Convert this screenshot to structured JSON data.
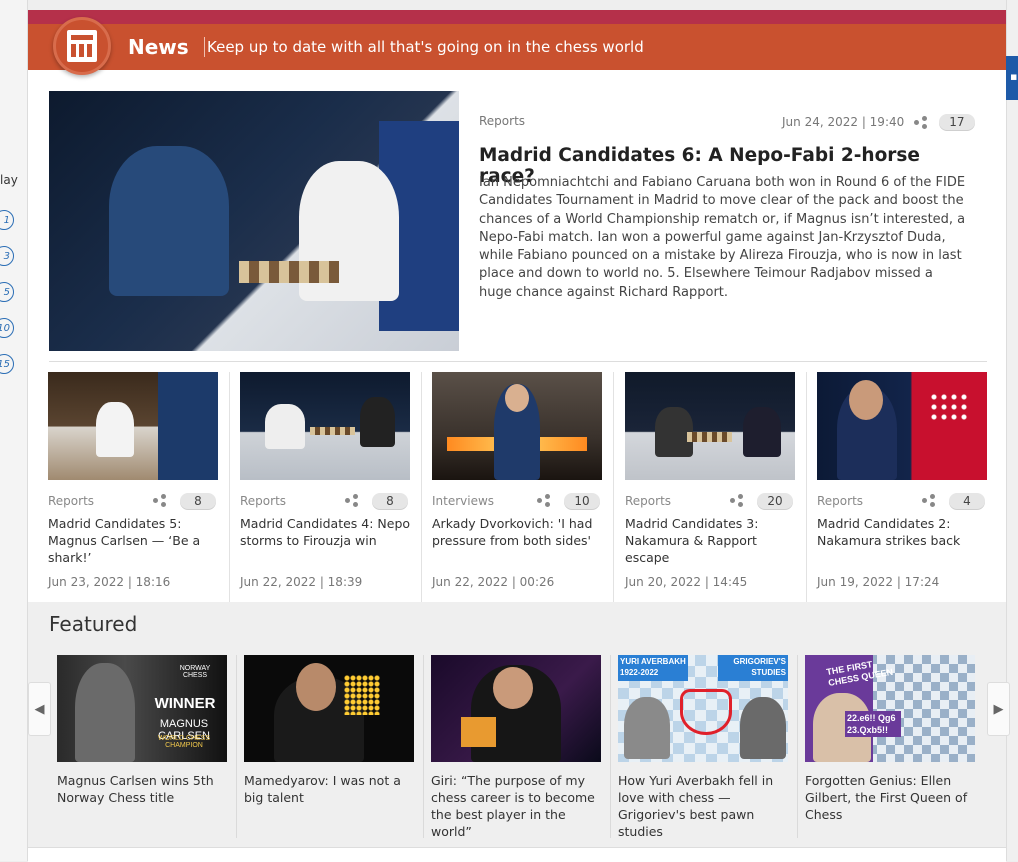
{
  "left_sidebar": {
    "label": "lay",
    "items": [
      "1",
      "3",
      "5",
      "10",
      "15"
    ]
  },
  "banner": {
    "title": "News",
    "subtitle": "Keep up to date with all that's going on in the chess world",
    "color": "#c9512f",
    "topline_color": "#b5304a"
  },
  "hero": {
    "category": "Reports",
    "date": "Jun 24, 2022 | 19:40",
    "comments": "17",
    "title": "Madrid Candidates 6: A Nepo-Fabi 2-horse race?",
    "summary": "Ian Nepomniachtchi and Fabiano Caruana both won in Round 6 of the FIDE Candidates Tournament in Madrid to move clear of the pack and boost the chances of a World Championship rematch or, if Magnus isn’t interested, a Nepo-Fabi match. Ian won a powerful game against Jan-Krzysztof Duda, while Fabiano pounced on a mistake by Alireza Firouzja, who is now in last place and down to world no. 5. Elsewhere Teimour Radjabov missed a huge chance against Richard Rapport."
  },
  "articles": [
    {
      "category": "Reports",
      "comments": "8",
      "title": "Madrid Candidates 5: Magnus Carlsen — ‘Be a shark!’",
      "date": "Jun 23, 2022 | 18:16"
    },
    {
      "category": "Reports",
      "comments": "8",
      "title": "Madrid Candidates 4: Nepo storms to Firouzja win",
      "date": "Jun 22, 2022 | 18:39"
    },
    {
      "category": "Interviews",
      "comments": "10",
      "title": "Arkady Dvorkovich: 'I had pressure from both sides'",
      "date": "Jun 22, 2022 | 00:26"
    },
    {
      "category": "Reports",
      "comments": "20",
      "title": "Madrid Candidates 3: Nakamura & Rapport escape",
      "date": "Jun 20, 2022 | 14:45"
    },
    {
      "category": "Reports",
      "comments": "4",
      "title": "Madrid Candidates 2: Nakamura strikes back",
      "date": "Jun 19, 2022 | 17:24"
    }
  ],
  "featured": {
    "title": "Featured",
    "items": [
      {
        "title": "Magnus Carlsen wins 5th Norway Chess title",
        "overlay": [
          "WINNER",
          "MAGNUS CARLSEN",
          "WORLD CHESS CHAMPION"
        ],
        "overlay_small": "NORWAY CHESS"
      },
      {
        "title": "Mamedyarov: I was not a big talent"
      },
      {
        "title": "Giri: “The purpose of my chess career is to become the best player in the world”"
      },
      {
        "title": "How Yuri Averbakh fell in love with chess — Grigoriev's best pawn studies",
        "overlay": [
          "YURI AVERBAKH 1922-2022",
          "GRIGORIEV'S STUDIES"
        ]
      },
      {
        "title": "Forgotten Genius: Ellen Gilbert, the First Queen of Chess",
        "overlay": [
          "THE FIRST CHESS QUEEN",
          "22.e6!! Qg6 23.Qxb5!!"
        ]
      }
    ]
  }
}
